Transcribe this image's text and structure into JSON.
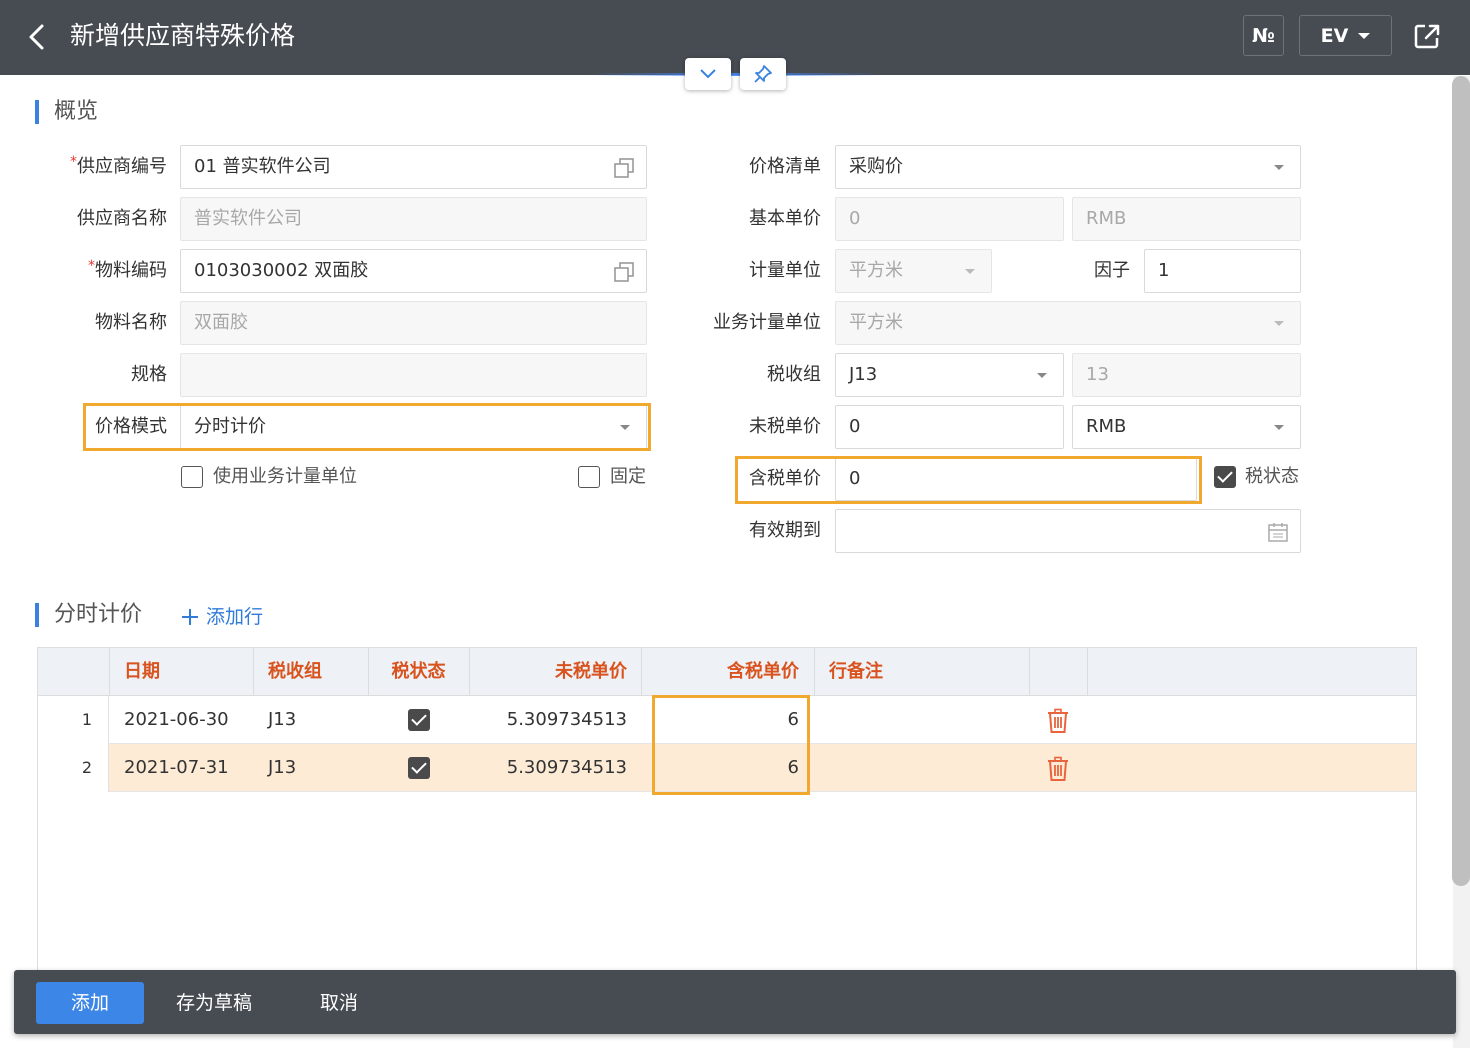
{
  "header": {
    "title": "新增供应商特殊价格",
    "no_button": "№",
    "ev_button": "EV"
  },
  "overview": {
    "section_title": "概览",
    "left": {
      "supplier_code_label": "供应商编号",
      "supplier_code_value": "01 普实软件公司",
      "supplier_name_label": "供应商名称",
      "supplier_name_value": "普实软件公司",
      "material_code_label": "物料编码",
      "material_code_value": "0103030002 双面胶",
      "material_name_label": "物料名称",
      "material_name_value": "双面胶",
      "spec_label": "规格",
      "spec_value": "",
      "price_mode_label": "价格模式",
      "price_mode_value": "分时计价",
      "use_biz_unit_label": "使用业务计量单位",
      "use_biz_unit_checked": false,
      "fixed_label": "固定",
      "fixed_checked": false
    },
    "right": {
      "price_list_label": "价格清单",
      "price_list_value": "采购价",
      "base_price_label": "基本单价",
      "base_price_value": "0",
      "base_currency": "RMB",
      "unit_label": "计量单位",
      "unit_value": "平方米",
      "factor_label": "因子",
      "factor_value": "1",
      "biz_unit_label": "业务计量单位",
      "biz_unit_value": "平方米",
      "tax_group_label": "税收组",
      "tax_group_value": "J13",
      "tax_rate_value": "13",
      "untaxed_price_label": "未税单价",
      "untaxed_price_value": "0",
      "currency_value": "RMB",
      "taxed_price_label": "含税单价",
      "taxed_price_value": "0",
      "tax_status_label": "税状态",
      "tax_status_checked": true,
      "valid_until_label": "有效期到",
      "valid_until_value": ""
    }
  },
  "timed_pricing": {
    "section_title": "分时计价",
    "add_row_label": "添加行",
    "columns": {
      "date": "日期",
      "tax_group": "税收组",
      "tax_status": "税状态",
      "untaxed_price": "未税单价",
      "taxed_price": "含税单价",
      "remark": "行备注"
    },
    "rows": [
      {
        "num": "1",
        "date": "2021-06-30",
        "tax_group": "J13",
        "tax_status": true,
        "untaxed_price": "5.309734513",
        "taxed_price": "6",
        "remark": ""
      },
      {
        "num": "2",
        "date": "2021-07-31",
        "tax_group": "J13",
        "tax_status": true,
        "untaxed_price": "5.309734513",
        "taxed_price": "6",
        "remark": ""
      }
    ]
  },
  "footer": {
    "add_label": "添加",
    "save_draft_label": "存为草稿",
    "cancel_label": "取消"
  },
  "colors": {
    "header_bg": "#474b52",
    "primary": "#3b86e6",
    "highlight": "#f0a92e",
    "column_header_text": "#d9531e",
    "selected_row": "#fdebd6"
  }
}
